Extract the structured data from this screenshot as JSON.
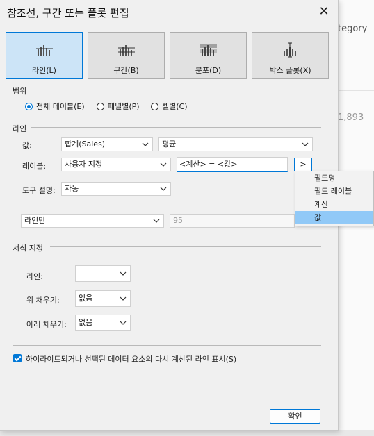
{
  "background": {
    "header_text": "tegory",
    "value_text": "1,893"
  },
  "dialog": {
    "title": "참조선, 구간 또는 플롯 편집",
    "tabs": [
      {
        "label": "라인(L)",
        "icon": "line-chart-icon",
        "selected": true
      },
      {
        "label": "구간(B)",
        "icon": "band-chart-icon",
        "selected": false
      },
      {
        "label": "분포(D)",
        "icon": "distribution-chart-icon",
        "selected": false
      },
      {
        "label": "박스 플롯(X)",
        "icon": "box-plot-icon",
        "selected": false
      }
    ],
    "scope": {
      "section_label": "범위",
      "options": [
        {
          "label": "전체 테이블(E)",
          "selected": true
        },
        {
          "label": "패널별(P)",
          "selected": false
        },
        {
          "label": "셀별(C)",
          "selected": false
        }
      ]
    },
    "line": {
      "section_label": "라인",
      "value_label": "값:",
      "value_field": "합계(Sales)",
      "value_aggregation": "평균",
      "label_label": "레이블:",
      "label_type": "사용자 지정",
      "label_text": "<계산> = <값>",
      "insert_button": ">",
      "tooltip_label": "도구 설명:",
      "tooltip_value": "자동",
      "line_only": "라인만",
      "confidence_value": "95"
    },
    "insert_menu": {
      "items": [
        "필드명",
        "필드 레이블",
        "계산",
        "값"
      ],
      "highlighted": 3
    },
    "format": {
      "section_label": "서식 지정",
      "line_label": "라인:",
      "fill_above_label": "위 채우기:",
      "fill_above_value": "없음",
      "fill_below_label": "아래 채우기:",
      "fill_below_value": "없음"
    },
    "recalc_checkbox": {
      "label": "하이라이트되거나 선택된 데이터 요소의 다시 계산된 라인 표시(S)",
      "checked": true
    },
    "ok_button": "확인",
    "colors": {
      "accent": "#0078d7",
      "selected_tab": "#cce4f7",
      "menu_highlight": "#91c9f7"
    }
  }
}
